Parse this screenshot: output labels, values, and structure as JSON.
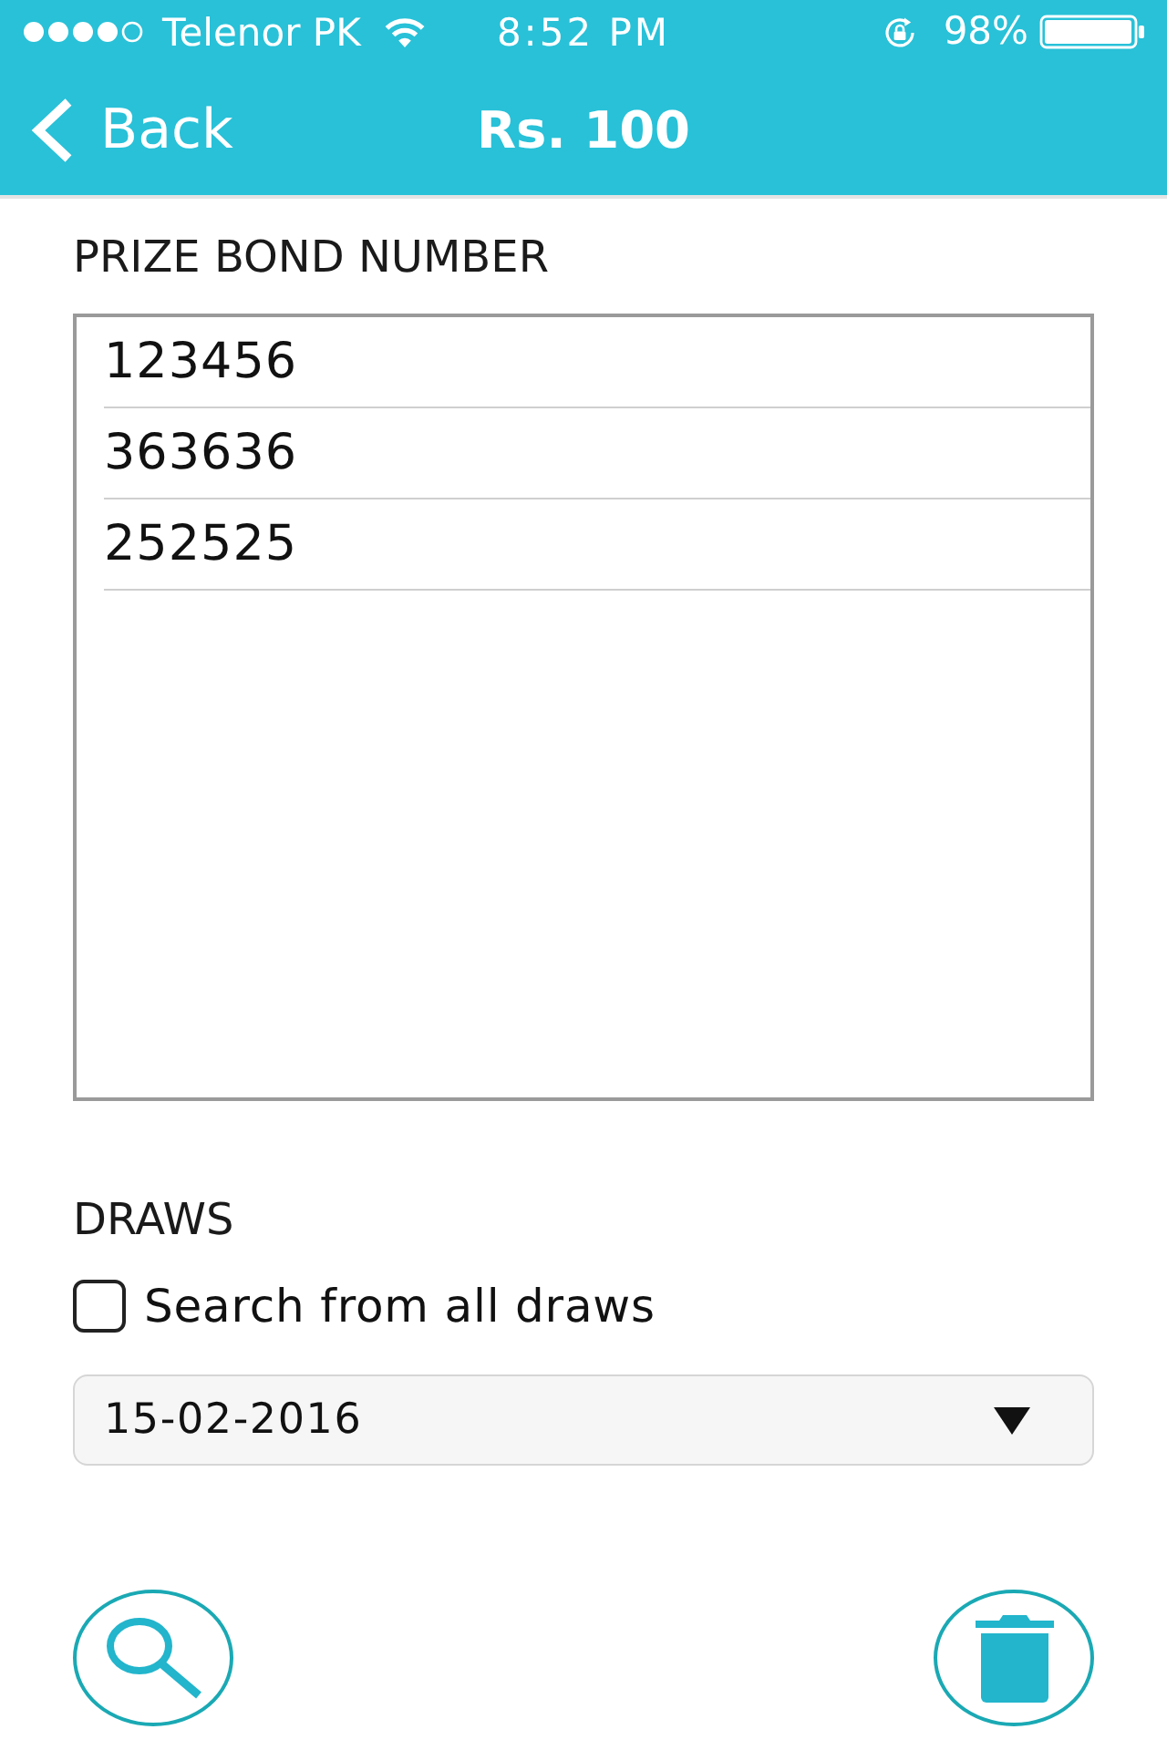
{
  "status_bar": {
    "carrier": "Telenor PK",
    "time": "8:52 PM",
    "battery": "98%"
  },
  "nav": {
    "back": "Back",
    "title": "Rs. 100"
  },
  "bond_numbers": {
    "label": "PRIZE BOND NUMBER",
    "entries": [
      "123456",
      "363636",
      "252525"
    ]
  },
  "draws": {
    "label": "DRAWS",
    "all_draws": {
      "label": "Search from all draws",
      "checked": false
    },
    "date": {
      "value": "15-02-2016"
    }
  },
  "actions": [
    {
      "kind": "search"
    },
    {
      "kind": "delete"
    }
  ]
}
